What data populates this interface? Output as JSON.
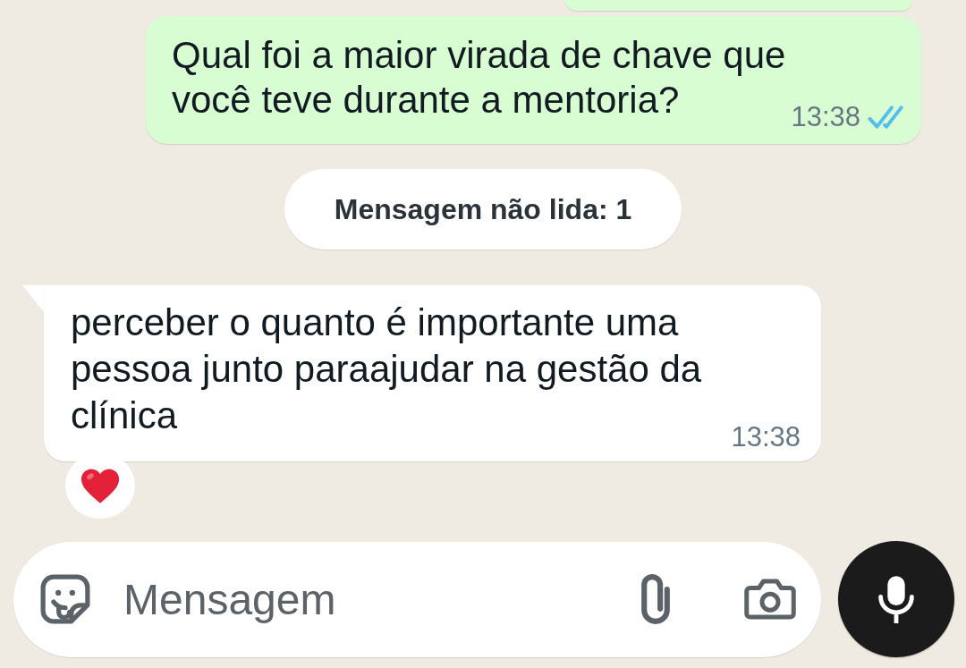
{
  "chat": [
    {
      "kind": "clipped",
      "outgoing": true
    },
    {
      "kind": "text",
      "outgoing": true,
      "tail": false,
      "text": "Qual foi a maior virada de chave que você teve durante a mentoria?",
      "time": "13:38",
      "read": true
    },
    {
      "kind": "unread_banner",
      "text": "Mensagem não lida: 1"
    },
    {
      "kind": "text",
      "outgoing": false,
      "tail": true,
      "text": "perceber o quanto é importante uma pessoa junto paraajudar na gestão da clínica",
      "time": "13:38",
      "reaction": {
        "kind": "heart"
      }
    }
  ],
  "composer": {
    "placeholder": "Mensagem"
  }
}
